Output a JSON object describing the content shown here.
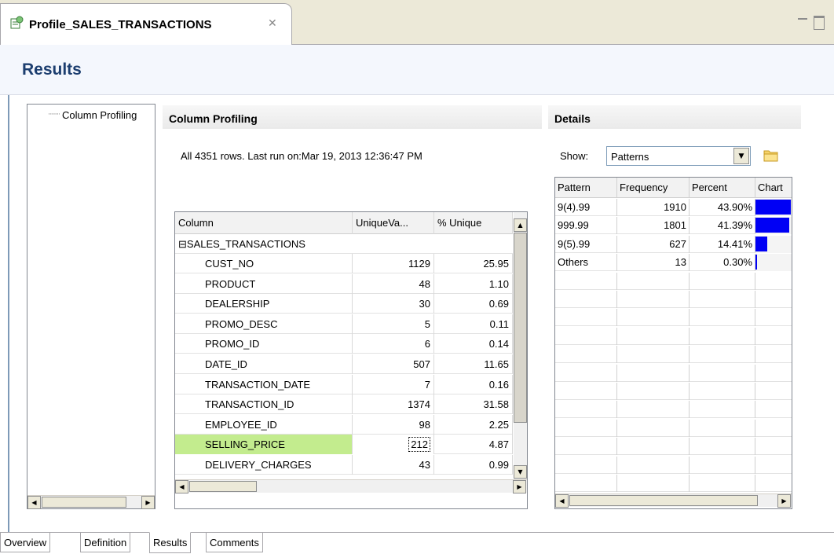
{
  "editor_tab": {
    "title": "Profile_SALES_TRANSACTIONS",
    "close_glyph": "✕",
    "icon": "profile-icon"
  },
  "header": {
    "title": "Results"
  },
  "tree": {
    "items": [
      {
        "label": "Column Profiling"
      }
    ]
  },
  "column_profiling": {
    "title": "Column Profiling",
    "run_info": "All 4351  rows. Last run on:Mar 19, 2013 12:36:47 PM",
    "headers": [
      "Column",
      "UniqueVa...",
      "% Unique"
    ],
    "group": {
      "expander": "⊟",
      "name": "SALES_TRANSACTIONS"
    },
    "rows": [
      {
        "name": "CUST_NO",
        "unique": "1129",
        "pct": "25.95"
      },
      {
        "name": "PRODUCT",
        "unique": "48",
        "pct": "1.10"
      },
      {
        "name": "DEALERSHIP",
        "unique": "30",
        "pct": "0.69"
      },
      {
        "name": "PROMO_DESC",
        "unique": "5",
        "pct": "0.11"
      },
      {
        "name": "PROMO_ID",
        "unique": "6",
        "pct": "0.14"
      },
      {
        "name": "DATE_ID",
        "unique": "507",
        "pct": "11.65"
      },
      {
        "name": "TRANSACTION_DATE",
        "unique": "7",
        "pct": "0.16"
      },
      {
        "name": "TRANSACTION_ID",
        "unique": "1374",
        "pct": "31.58"
      },
      {
        "name": "EMPLOYEE_ID",
        "unique": "98",
        "pct": "2.25"
      },
      {
        "name": "SELLING_PRICE",
        "unique": "212",
        "pct": "4.87",
        "selected": true
      },
      {
        "name": "DELIVERY_CHARGES",
        "unique": "43",
        "pct": "0.99"
      }
    ]
  },
  "details": {
    "title": "Details",
    "show_label": "Show:",
    "show_value": "Patterns",
    "headers": [
      "Pattern",
      "Frequency",
      "Percent",
      "Chart"
    ],
    "rows": [
      {
        "pattern": "9(4).99",
        "frequency": "1910",
        "percent": "43.90%",
        "fraction": 0.439
      },
      {
        "pattern": "999.99",
        "frequency": "1801",
        "percent": "41.39%",
        "fraction": 0.4139
      },
      {
        "pattern": "9(5).99",
        "frequency": "627",
        "percent": "14.41%",
        "fraction": 0.1441
      },
      {
        "pattern": "Others",
        "frequency": "13",
        "percent": "0.30%",
        "fraction": 0.003
      }
    ],
    "bar_color": "#0000f5"
  },
  "bottom_tabs": [
    "Overview",
    "Definition",
    "Results",
    "Comments"
  ],
  "colors": {
    "selected_row": "#c3ec8e",
    "header_text": "#1c3e6f"
  }
}
